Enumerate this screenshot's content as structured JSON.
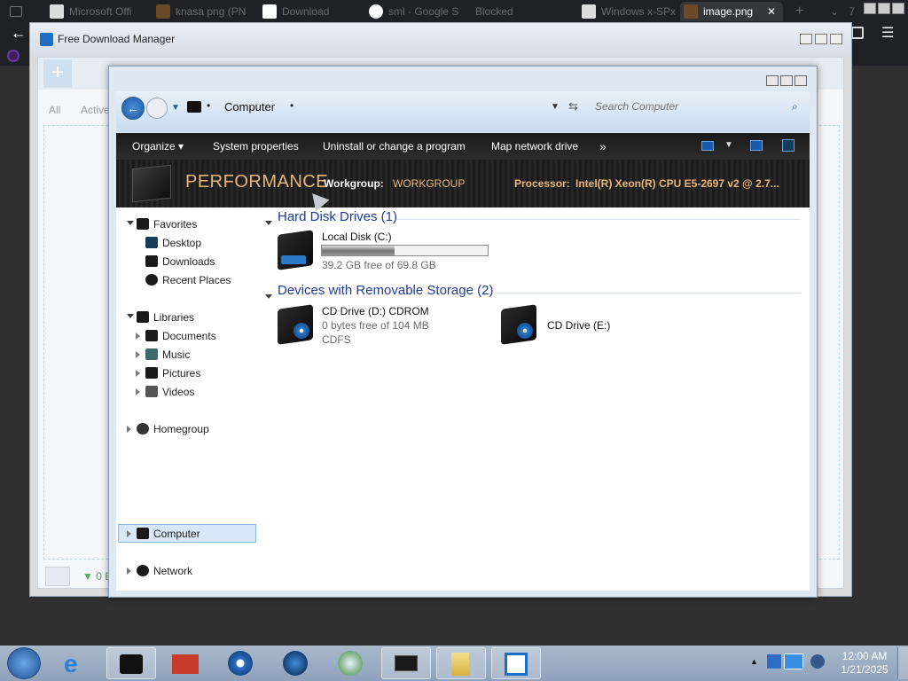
{
  "browser": {
    "tabs": [
      {
        "label": "Microsoft Offi",
        "icon": "archive-icon"
      },
      {
        "label": "knasa png (PN",
        "icon": "image-icon"
      },
      {
        "label": "Download",
        "icon": "7zip-icon"
      },
      {
        "label": "sml - Google S",
        "icon": "google-icon"
      },
      {
        "label": "Blocked",
        "icon": "blocked-icon"
      },
      {
        "label": "Windows x-SPx",
        "icon": "archive-icon"
      },
      {
        "label": "image.png",
        "icon": "image-icon"
      }
    ],
    "tab_close": "✕",
    "new_tab": "+",
    "tab_count": "7"
  },
  "fdm": {
    "title": "Free Download Manager",
    "filter_all": "All",
    "filter_active": "Active",
    "status_count": "▼ 0 E"
  },
  "explorer": {
    "address": "Computer",
    "search_placeholder": "Search Computer",
    "toolbar": {
      "organize": "Organize ▾",
      "system_properties": "System properties",
      "uninstall": "Uninstall or change a program",
      "map_drive": "Map network drive",
      "more": "»"
    },
    "banner": {
      "performance": "PERFORMANCE",
      "workgroup_label": "Workgroup:",
      "workgroup_value": "WORKGROUP",
      "processor_label": "Processor:",
      "processor_value": "Intel(R) Xeon(R) CPU E5-2697 v2 @ 2.7..."
    },
    "nav": {
      "favorites": "Favorites",
      "desktop": "Desktop",
      "downloads": "Downloads",
      "recent_places": "Recent Places",
      "libraries": "Libraries",
      "documents": "Documents",
      "music": "Music",
      "pictures": "Pictures",
      "videos": "Videos",
      "homegroup": "Homegroup",
      "computer": "Computer",
      "network": "Network"
    },
    "groups": {
      "hdd": "Hard Disk Drives (1)",
      "removable": "Devices with Removable Storage (2)"
    },
    "drives": {
      "c": {
        "name": "Local Disk (C:)",
        "free": "39.2 GB free of 69.8 GB",
        "used_fraction": 0.44
      },
      "d": {
        "name": "CD Drive (D:) CDROM",
        "free": "0 bytes free of 104 MB",
        "fs": "CDFS"
      },
      "e": {
        "name": "CD Drive (E:)"
      }
    }
  },
  "taskbar": {
    "time": "12:00 AM",
    "date": "1/21/2025"
  }
}
